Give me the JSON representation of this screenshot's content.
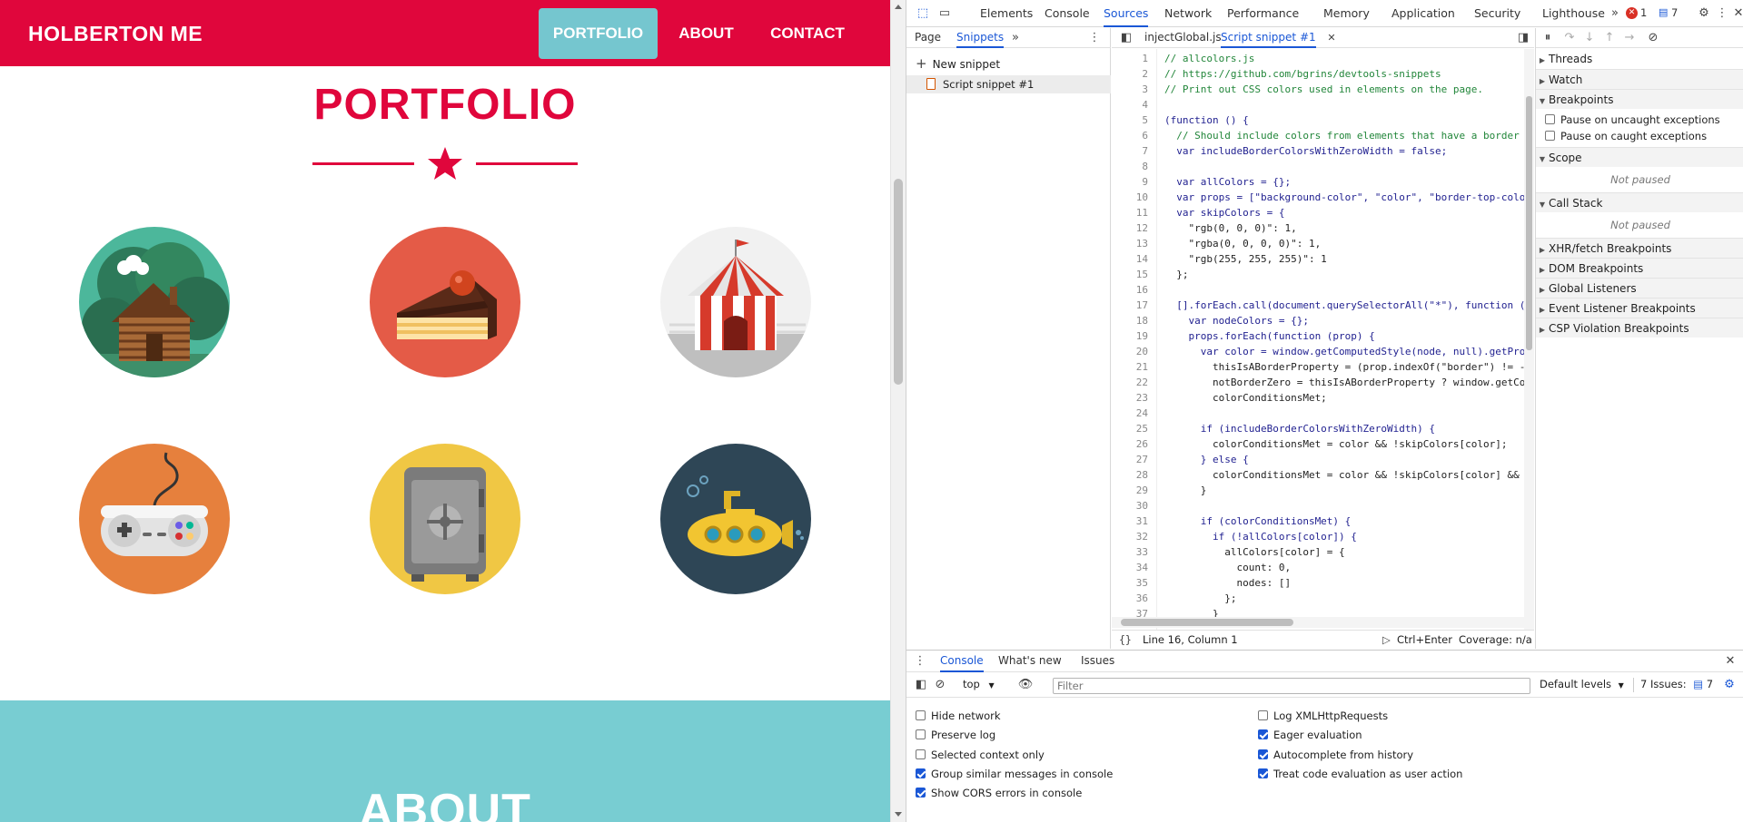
{
  "site": {
    "brand": "HOLBERTON ME",
    "nav": {
      "portfolio": "PORTFOLIO",
      "about": "ABOUT",
      "contact": "CONTACT"
    },
    "portfolio_title": "PORTFOLIO",
    "about_title": "ABOUT",
    "colors": {
      "primary": "#e0063c",
      "teal": "#75c6cf",
      "about_bg": "#78cdd2"
    },
    "tiles": [
      {
        "name": "cabin",
        "bg": "#b94b64",
        "circle": "#4cb79b"
      },
      {
        "name": "cake",
        "bg": "#21a5b7",
        "circle": "#e45b47"
      },
      {
        "name": "circus-tent",
        "bg": "#141112",
        "circle": "#f1f1f1"
      },
      {
        "name": "game-controller",
        "bg": "#1f88c6",
        "circle": "#e6803d"
      },
      {
        "name": "safe",
        "bg": "#1137b8",
        "circle": "#f0c744"
      },
      {
        "name": "submarine",
        "bg": "#cbaea2",
        "circle": "#2e4656"
      }
    ]
  },
  "devtools": {
    "tabs": [
      "Elements",
      "Console",
      "Sources",
      "Network",
      "Performance",
      "Memory",
      "Application",
      "Security",
      "Lighthouse"
    ],
    "active_tab": "Sources",
    "badges": {
      "errors": "1",
      "messages": "7"
    },
    "navigator": {
      "tabs": [
        "Page",
        "Snippets"
      ],
      "active": "Snippets",
      "new_snippet": "New snippet",
      "snippets": [
        "Script snippet #1"
      ]
    },
    "editor": {
      "tabs": [
        "injectGlobal.js",
        "Script snippet #1"
      ],
      "active": "Script snippet #1",
      "lines": [
        "// allcolors.js",
        "// https://github.com/bgrins/devtools-snippets",
        "// Print out CSS colors used in elements on the page.",
        "",
        "(function () {",
        "  // Should include colors from elements that have a border",
        "  var includeBorderColorsWithZeroWidth = false;",
        "",
        "  var allColors = {};",
        "  var props = [\"background-color\", \"color\", \"border-top-colo",
        "  var skipColors = {",
        "    \"rgb(0, 0, 0)\": 1,",
        "    \"rgba(0, 0, 0, 0)\": 1,",
        "    \"rgb(255, 255, 255)\": 1",
        "  };",
        "",
        "  [].forEach.call(document.querySelectorAll(\"*\"), function (",
        "    var nodeColors = {};",
        "    props.forEach(function (prop) {",
        "      var color = window.getComputedStyle(node, null).getPro",
        "        thisIsABorderProperty = (prop.indexOf(\"border\") != -",
        "        notBorderZero = thisIsABorderProperty ? window.getCo",
        "        colorConditionsMet;",
        "",
        "      if (includeBorderColorsWithZeroWidth) {",
        "        colorConditionsMet = color && !skipColors[color];",
        "      } else {",
        "        colorConditionsMet = color && !skipColors[color] &&",
        "      }",
        "",
        "      if (colorConditionsMet) {",
        "        if (!allColors[color]) {",
        "          allColors[color] = {",
        "            count: 0,",
        "            nodes: []",
        "          };",
        "        }"
      ],
      "status_position": "Line 16, Column 1",
      "run_shortcut": "Ctrl+Enter",
      "coverage": "Coverage: n/a"
    },
    "debugger": {
      "threads": "Threads",
      "watch": "Watch",
      "breakpoints": "Breakpoints",
      "pause_uncaught": "Pause on uncaught exceptions",
      "pause_caught": "Pause on caught exceptions",
      "scope": "Scope",
      "not_paused": "Not paused",
      "call_stack": "Call Stack",
      "xhr": "XHR/fetch Breakpoints",
      "dom": "DOM Breakpoints",
      "global_listeners": "Global Listeners",
      "event_listener": "Event Listener Breakpoints",
      "csp": "CSP Violation Breakpoints"
    },
    "drawer": {
      "tabs": [
        "Console",
        "What's new",
        "Issues"
      ],
      "active": "Console",
      "context": "top",
      "filter_placeholder": "Filter",
      "levels": "Default levels",
      "issues_label": "7 Issues:",
      "issues_count": "7",
      "options_left": [
        {
          "label": "Hide network",
          "checked": false
        },
        {
          "label": "Preserve log",
          "checked": false
        },
        {
          "label": "Selected context only",
          "checked": false
        },
        {
          "label": "Group similar messages in console",
          "checked": true
        },
        {
          "label": "Show CORS errors in console",
          "checked": true
        }
      ],
      "options_right": [
        {
          "label": "Log XMLHttpRequests",
          "checked": false
        },
        {
          "label": "Eager evaluation",
          "checked": true
        },
        {
          "label": "Autocomplete from history",
          "checked": true
        },
        {
          "label": "Treat code evaluation as user action",
          "checked": true
        }
      ]
    }
  }
}
